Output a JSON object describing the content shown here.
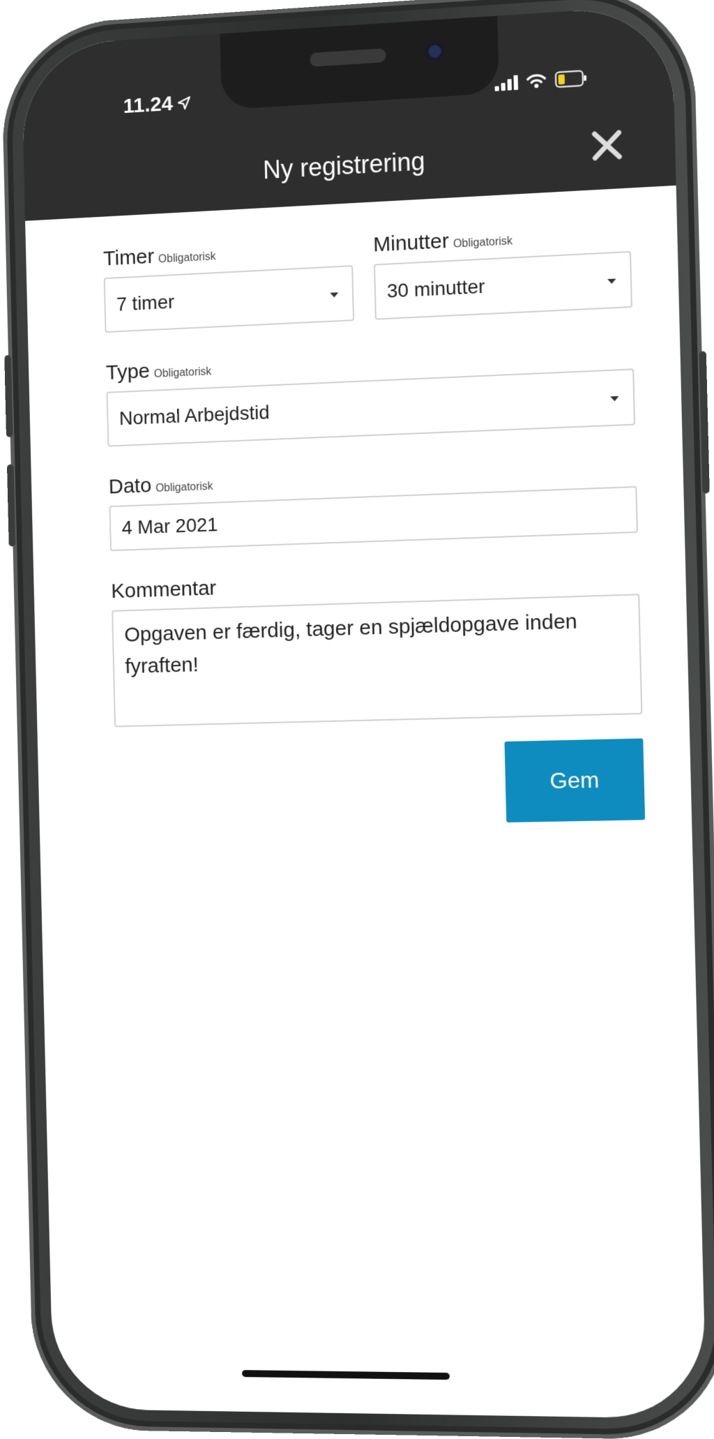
{
  "status_bar": {
    "time": "11.24",
    "icons": [
      "location-arrow-icon",
      "cellular-signal-icon",
      "wifi-icon",
      "battery-icon"
    ]
  },
  "header": {
    "title": "Ny registrering",
    "close_icon": "close-icon"
  },
  "form": {
    "hours": {
      "label": "Timer",
      "required": "Obligatorisk",
      "value": "7 timer"
    },
    "minutes": {
      "label": "Minutter",
      "required": "Obligatorisk",
      "value": "30 minutter"
    },
    "type": {
      "label": "Type",
      "required": "Obligatorisk",
      "value": "Normal Arbejdstid"
    },
    "date": {
      "label": "Dato",
      "required": "Obligatorisk",
      "value": "4 Mar 2021"
    },
    "comment": {
      "label": "Kommentar",
      "value": "Opgaven er færdig, tager en spjældopgave inden fyraften!"
    },
    "save_label": "Gem"
  },
  "colors": {
    "header_bg": "#2e2e2e",
    "accent": "#0e8cbf",
    "battery_level": "#f2d21b"
  }
}
